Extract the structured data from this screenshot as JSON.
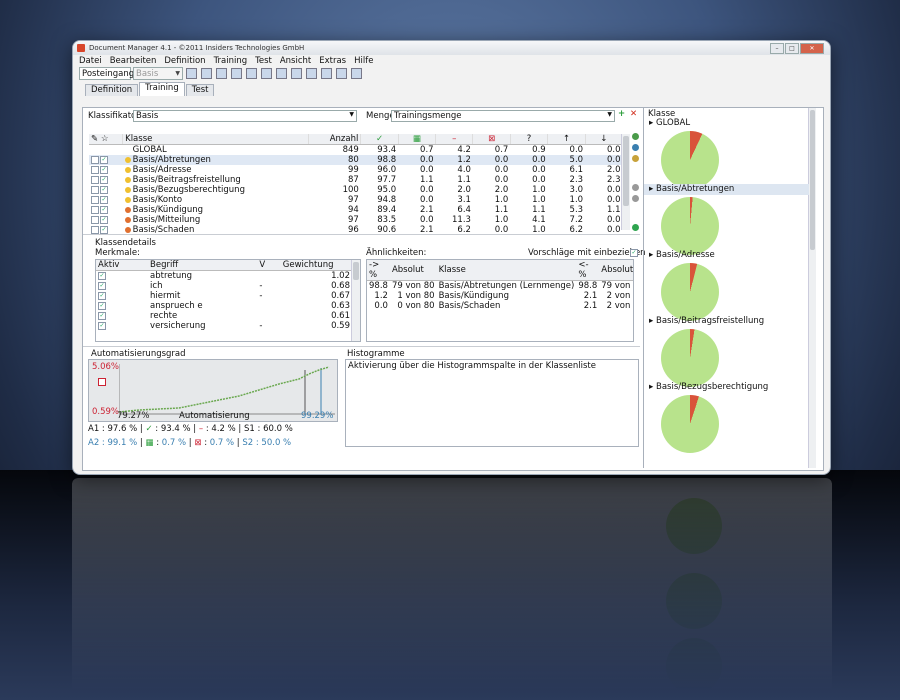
{
  "window": {
    "title": "Document Manager 4.1 - ©2011 Insiders Technologies GmbH"
  },
  "menu": [
    "Datei",
    "Bearbeiten",
    "Definition",
    "Training",
    "Test",
    "Ansicht",
    "Extras",
    "Hilfe"
  ],
  "toolbar": {
    "combo1": "Posteingang",
    "combo2": "Basis"
  },
  "tabs": [
    "Definition",
    "Training",
    "Test"
  ],
  "classifier": {
    "label": "Klassifikator",
    "value": "Basis",
    "set_label": "Menge",
    "set_value": "Trainingsmenge"
  },
  "grid": {
    "headers": [
      "Klasse",
      "Anzahl"
    ],
    "rows": [
      {
        "name": "GLOBAL",
        "count": "849",
        "v1": "93.4",
        "v2": "0.7",
        "v3": "4.2",
        "v4": "0.7",
        "v5": "0.9",
        "v6": "0.0",
        "v7": "0.0"
      },
      {
        "name": "Basis/Abtretungen",
        "count": "80",
        "v1": "98.8",
        "v2": "0.0",
        "v3": "1.2",
        "v4": "0.0",
        "v5": "0.0",
        "v6": "5.0",
        "v7": "0.0"
      },
      {
        "name": "Basis/Adresse",
        "count": "99",
        "v1": "96.0",
        "v2": "0.0",
        "v3": "4.0",
        "v4": "0.0",
        "v5": "0.0",
        "v6": "6.1",
        "v7": "2.0"
      },
      {
        "name": "Basis/Beitragsfreistellung",
        "count": "87",
        "v1": "97.7",
        "v2": "1.1",
        "v3": "1.1",
        "v4": "0.0",
        "v5": "0.0",
        "v6": "2.3",
        "v7": "2.3"
      },
      {
        "name": "Basis/Bezugsberechtigung",
        "count": "100",
        "v1": "95.0",
        "v2": "0.0",
        "v3": "2.0",
        "v4": "2.0",
        "v5": "1.0",
        "v6": "3.0",
        "v7": "0.0"
      },
      {
        "name": "Basis/Konto",
        "count": "97",
        "v1": "94.8",
        "v2": "0.0",
        "v3": "3.1",
        "v4": "1.0",
        "v5": "1.0",
        "v6": "1.0",
        "v7": "0.0"
      },
      {
        "name": "Basis/Kündigung",
        "count": "94",
        "v1": "89.4",
        "v2": "2.1",
        "v3": "6.4",
        "v4": "1.1",
        "v5": "1.1",
        "v6": "5.3",
        "v7": "1.1"
      },
      {
        "name": "Basis/Mitteilung",
        "count": "97",
        "v1": "83.5",
        "v2": "0.0",
        "v3": "11.3",
        "v4": "1.0",
        "v5": "4.1",
        "v6": "7.2",
        "v7": "0.0"
      },
      {
        "name": "Basis/Schaden",
        "count": "96",
        "v1": "90.6",
        "v2": "2.1",
        "v3": "6.2",
        "v4": "0.0",
        "v5": "1.0",
        "v6": "6.2",
        "v7": "0.0"
      }
    ]
  },
  "details": {
    "title": "Klassendetails",
    "merkmale": "Merkmale:",
    "headers": [
      "Aktiv",
      "Begriff",
      "V",
      "Gewichtung"
    ],
    "rows": [
      {
        "term": "abtretung",
        "v": "",
        "w": "1.02"
      },
      {
        "term": "ich",
        "v": "-",
        "w": "0.68"
      },
      {
        "term": "hiermit",
        "v": "-",
        "w": "0.67"
      },
      {
        "term": "anspruech e",
        "v": "",
        "w": "0.63"
      },
      {
        "term": "rechte",
        "v": "",
        "w": "0.61"
      },
      {
        "term": "versicherung",
        "v": "-",
        "w": "0.59"
      }
    ],
    "sim_title": "Ähnlichkeiten:",
    "sim_check": "Vorschläge mit einbeziehen",
    "sim_headers": [
      "-> %",
      "Absolut",
      "Klasse",
      "<- %",
      "Absolut"
    ],
    "sim_rows": [
      {
        "p1": "98.8",
        "a1": "79 von 80",
        "cls": "Basis/Abtretungen (Lernmenge)",
        "p2": "98.8",
        "a2": "79 von 80"
      },
      {
        "p1": "1.2",
        "a1": "1 von 80",
        "cls": "Basis/Kündigung",
        "p2": "2.1",
        "a2": "2 von 94"
      },
      {
        "p1": "0.0",
        "a1": "0 von 80",
        "cls": "Basis/Schaden",
        "p2": "2.1",
        "a2": "2 von 96"
      }
    ]
  },
  "automation": {
    "title": "Automatisierungsgrad",
    "y_top": "5.06%",
    "y_bottom": "0.59%",
    "x_left": "79.27%",
    "x_right": "99.29%",
    "xlabel": "Automatisierung",
    "stats1": [
      "A1 : 97.6 %",
      "93.4 %",
      "4.2 %",
      "S1 : 60.0 %"
    ],
    "stats2": [
      "A2 : 99.1 %",
      "0.7 %",
      "0.7 %",
      "S2 : 50.0 %"
    ]
  },
  "histogram": {
    "title": "Histogramme",
    "text": "Aktivierung über die Histogrammspalte in der Klassenliste"
  },
  "pies": {
    "header": "Klasse",
    "items": [
      {
        "name": "GLOBAL",
        "error": 7.0
      },
      {
        "name": "Basis/Abtretungen",
        "error": 1.5
      },
      {
        "name": "Basis/Adresse",
        "error": 4.0
      },
      {
        "name": "Basis/Beitragsfreistellung",
        "error": 2.5
      },
      {
        "name": "Basis/Bezugsberechtigung",
        "error": 5.0
      }
    ]
  },
  "colors": {
    "pie_ok": "#b8e38c",
    "pie_err": "#d9533a",
    "accent": "#3a7fb0"
  }
}
